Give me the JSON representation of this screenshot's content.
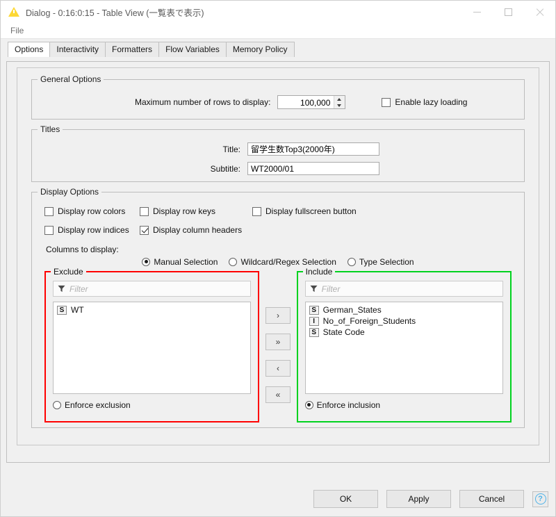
{
  "window": {
    "title": "Dialog - 0:16:0:15 - Table View (一覧表で表示)",
    "app_icon": "warning-triangle-icon",
    "controls": {
      "minimize": "minimize-icon",
      "maximize": "maximize-icon",
      "close": "close-icon"
    }
  },
  "menubar": {
    "items": [
      {
        "label": "File"
      }
    ]
  },
  "tabs": [
    {
      "label": "Options",
      "active": true
    },
    {
      "label": "Interactivity",
      "active": false
    },
    {
      "label": "Formatters",
      "active": false
    },
    {
      "label": "Flow Variables",
      "active": false
    },
    {
      "label": "Memory Policy",
      "active": false
    }
  ],
  "general_options": {
    "legend": "General Options",
    "max_rows_label": "Maximum number of rows to display:",
    "max_rows_value": "100,000",
    "lazy_loading_label": "Enable lazy loading",
    "lazy_loading_checked": false
  },
  "titles": {
    "legend": "Titles",
    "title_label": "Title:",
    "title_value": "留学生数Top3(2000年)",
    "subtitle_label": "Subtitle:",
    "subtitle_value": "WT2000/01"
  },
  "display_options": {
    "legend": "Display Options",
    "checkboxes": [
      {
        "label": "Display row colors",
        "checked": false
      },
      {
        "label": "Display row keys",
        "checked": false
      },
      {
        "label": "Display fullscreen button",
        "checked": false
      },
      {
        "label": "Display row indices",
        "checked": false
      },
      {
        "label": "Display column headers",
        "checked": true
      }
    ],
    "columns_to_display_label": "Columns to display:"
  },
  "selection_mode": {
    "options": [
      {
        "label": "Manual Selection",
        "selected": true
      },
      {
        "label": "Wildcard/Regex Selection",
        "selected": false
      },
      {
        "label": "Type Selection",
        "selected": false
      }
    ]
  },
  "exclude_panel": {
    "legend": "Exclude",
    "border_color": "#ff0000",
    "filter_placeholder": "Filter",
    "filter_value": "",
    "items": [
      {
        "type": "S",
        "label": "WT"
      }
    ],
    "enforce_label": "Enforce exclusion",
    "enforce_selected": false
  },
  "include_panel": {
    "legend": "Include",
    "border_color": "#00d21e",
    "filter_placeholder": "Filter",
    "filter_value": "",
    "items": [
      {
        "type": "S",
        "label": "German_States"
      },
      {
        "type": "I",
        "label": "No_of_Foreign_Students"
      },
      {
        "type": "S",
        "label": "State Code"
      }
    ],
    "enforce_label": "Enforce inclusion",
    "enforce_selected": true
  },
  "transfer_buttons": [
    {
      "label": "›",
      "name": "move-right-button"
    },
    {
      "label": "»",
      "name": "move-all-right-button"
    },
    {
      "label": "‹",
      "name": "move-left-button"
    },
    {
      "label": "«",
      "name": "move-all-left-button"
    }
  ],
  "dialog_buttons": {
    "ok": "OK",
    "apply": "Apply",
    "cancel": "Cancel",
    "help": "help-icon",
    "help_glyph": "?"
  }
}
